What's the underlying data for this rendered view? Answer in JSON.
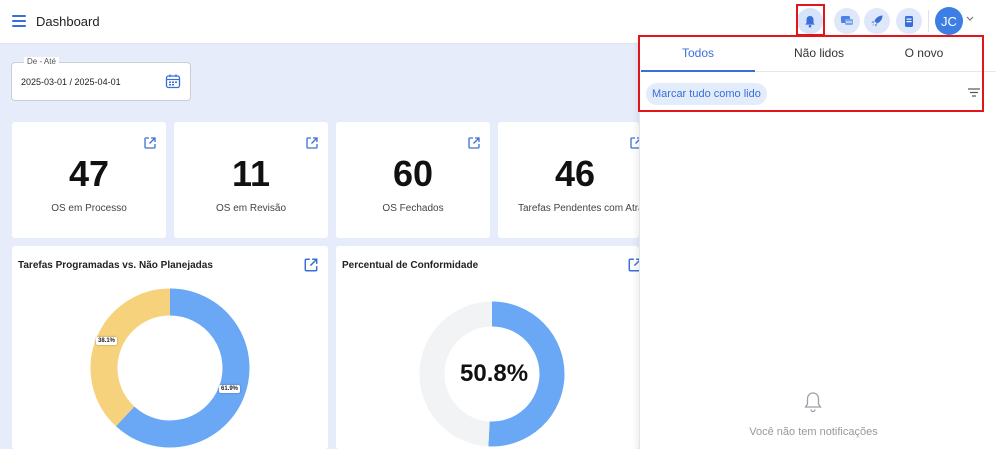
{
  "header": {
    "title": "Dashboard",
    "user_initials": "JC"
  },
  "date_filter": {
    "label": "De - Até",
    "value": "2025-03-01 / 2025-04-01"
  },
  "stats": [
    {
      "value": "47",
      "label": "OS em Processo"
    },
    {
      "value": "11",
      "label": "OS em Revisão"
    },
    {
      "value": "60",
      "label": "OS Fechados"
    },
    {
      "value": "46",
      "label": "Tarefas Pendentes com Atraso"
    }
  ],
  "charts": {
    "scheduled": {
      "title": "Tarefas Programadas vs. Não Planejadas",
      "label_a": "38.1%",
      "label_b": "61.9%"
    },
    "conformity": {
      "title": "Percentual de Conformidade",
      "center_label": "50.8%"
    }
  },
  "chart_data": [
    {
      "type": "pie",
      "title": "Tarefas Programadas vs. Não Planejadas",
      "values": [
        61.9,
        38.1
      ],
      "colors": [
        "#6aa8f5",
        "#f7d27d"
      ]
    },
    {
      "type": "pie",
      "title": "Percentual de Conformidade",
      "values": [
        50.8,
        49.2
      ],
      "colors": [
        "#6aa8f5",
        "#f1f3f5"
      ]
    }
  ],
  "notifications": {
    "tabs": [
      "Todos",
      "Não lidos",
      "O novo"
    ],
    "active_tab": "Todos",
    "mark_all_label": "Marcar tudo como lido",
    "empty_message": "Você não tem notificações"
  },
  "icons": {
    "menu": "hamburger-icon",
    "bell": "bell-icon",
    "chat": "chat-icon",
    "rocket": "rocket-icon",
    "document": "document-icon",
    "calendar": "calendar-icon",
    "external": "external-link-icon",
    "filter": "filter-icon"
  },
  "colors": {
    "accent": "#3a6fd8",
    "highlight": "#e0161b"
  }
}
